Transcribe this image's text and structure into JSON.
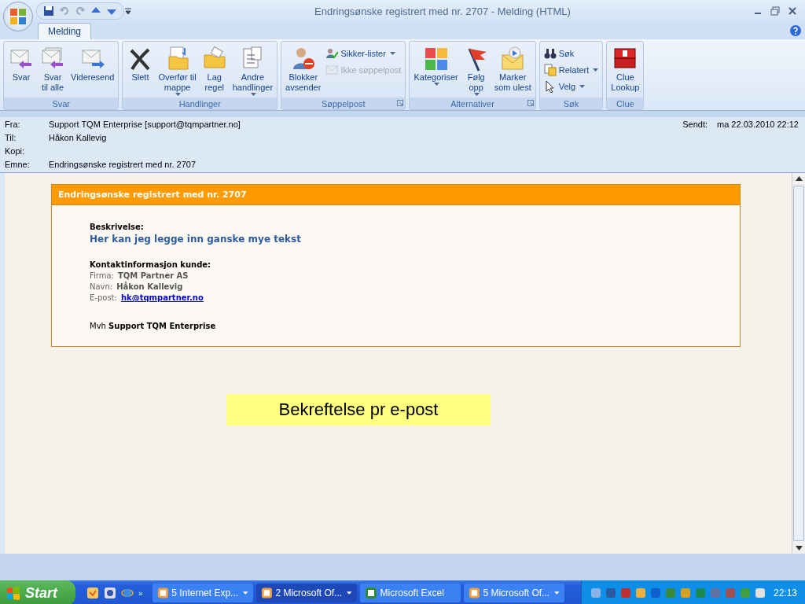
{
  "window": {
    "title": "Endringsønske registrert med nr. 2707 - Melding (HTML)"
  },
  "tabs": [
    {
      "label": "Melding",
      "selected": true
    }
  ],
  "ribbon_groups": [
    {
      "label": "Svar",
      "launcher": false,
      "buttons": [
        {
          "kind": "large",
          "label": "Svar",
          "dropdown": false
        },
        {
          "kind": "large",
          "label": "Svar\ntil alle",
          "dropdown": false
        },
        {
          "kind": "large",
          "label": "Videresend",
          "dropdown": false
        }
      ]
    },
    {
      "label": "Handlinger",
      "launcher": false,
      "buttons": [
        {
          "kind": "large",
          "label": "Slett",
          "dropdown": false
        },
        {
          "kind": "large",
          "label": "Overfør til\nmappe",
          "dropdown": true
        },
        {
          "kind": "large",
          "label": "Lag\nregel",
          "dropdown": false
        },
        {
          "kind": "large",
          "label": "Andre\nhandlinger",
          "dropdown": true
        }
      ]
    },
    {
      "label": "Søppelpost",
      "launcher": true,
      "buttons": [
        {
          "kind": "large",
          "label": "Blokker\navsender",
          "dropdown": false
        },
        {
          "kind": "small",
          "label": "Sikker-lister",
          "dropdown": true,
          "disabled": false
        },
        {
          "kind": "small",
          "label": "Ikke søppelpost",
          "dropdown": false,
          "disabled": true
        }
      ]
    },
    {
      "label": "Alternativer",
      "launcher": true,
      "buttons": [
        {
          "kind": "large",
          "label": "Kategoriser\n",
          "dropdown": true
        },
        {
          "kind": "large",
          "label": "Følg\nopp",
          "dropdown": true
        },
        {
          "kind": "large",
          "label": "Marker\nsom ulest",
          "dropdown": false
        }
      ]
    },
    {
      "label": "Søk",
      "launcher": false,
      "buttons": [
        {
          "kind": "small",
          "label": "Søk",
          "dropdown": false,
          "disabled": false
        },
        {
          "kind": "small",
          "label": "Relatert",
          "dropdown": true,
          "disabled": false
        },
        {
          "kind": "small",
          "label": "Velg",
          "dropdown": true,
          "disabled": false
        }
      ]
    },
    {
      "label": "Clue",
      "launcher": false,
      "buttons": [
        {
          "kind": "large",
          "label": "Clue\nLookup",
          "dropdown": false
        }
      ]
    }
  ],
  "header": {
    "fields": [
      {
        "label": "Fra:",
        "value": "Support TQM Enterprise [support@tqmpartner.no]"
      },
      {
        "label": "Til:",
        "value": "Håkon Kallevig"
      },
      {
        "label": "Kopi:"
      },
      {
        "label": "Emne:",
        "value": "Endringsønske registrert med nr. 2707"
      }
    ],
    "sent": {
      "label": "Sendt:",
      "value": "ma 22.03.2010 22:12"
    }
  },
  "message": {
    "title": "Endringsønske registrert med nr. 2707",
    "description_label": "Beskrivelse:",
    "description": "Her kan jeg legge inn ganske mye tekst",
    "contact_label": "Kontaktinformasjon kunde:",
    "contact_fields": [
      {
        "kind": "text",
        "label": "Firma:",
        "value": "TQM Partner AS"
      },
      {
        "kind": "text",
        "label": "Navn:",
        "value": "Håkon Kallevig"
      },
      {
        "kind": "link",
        "label": "E-post:",
        "value": "hk@tqmpartner.no"
      }
    ],
    "closing": "Mvh **Support TQM Enterprise**"
  },
  "note": "Bekreftelse pr e-post",
  "taskbar": {
    "start": "Start",
    "more": "»",
    "tasks": [
      {
        "label": "5 Internet Exp...",
        "selected": false,
        "dropdown": true
      },
      {
        "label": "2 Microsoft Of...",
        "selected": true,
        "dropdown": true
      },
      {
        "label": "Microsoft Excel",
        "selected": false,
        "dropdown": false
      },
      {
        "label": "5 Microsoft Of...",
        "selected": false,
        "dropdown": true
      }
    ],
    "clock": "22:13"
  }
}
